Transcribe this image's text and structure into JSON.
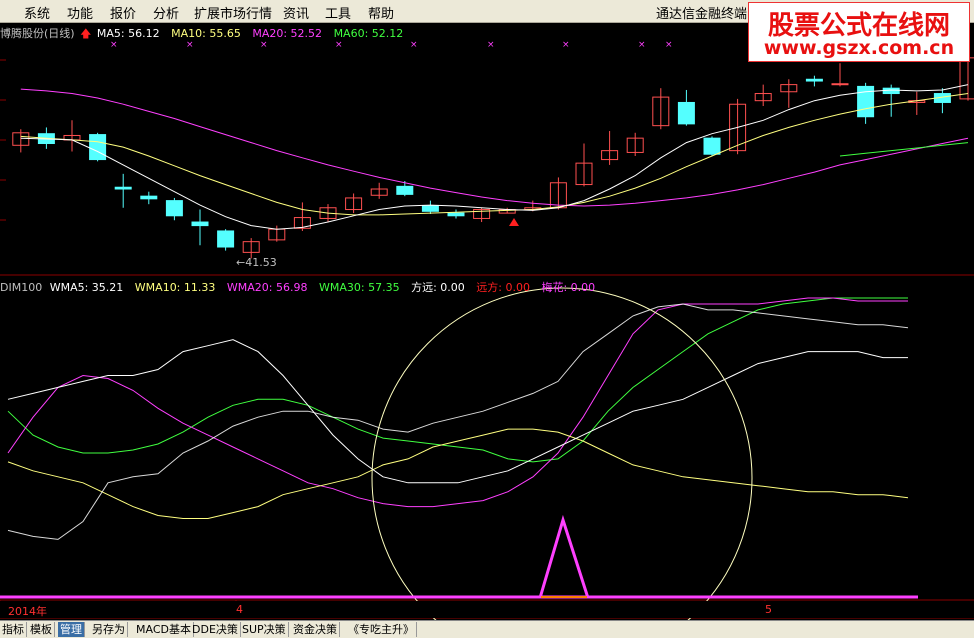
{
  "menu": {
    "items": [
      "系统",
      "功能",
      "报价",
      "分析",
      "扩展市场行情",
      "资讯",
      "工具",
      "帮助"
    ],
    "title": "通达信金融终端"
  },
  "watermark": {
    "line1": "股票公式在线网",
    "line2": "www.gszx.com.cn"
  },
  "main_panel": {
    "stock_name": "博腾股份(日线)",
    "ma5_label": "MA5: 56.12",
    "ma10_label": "MA10: 55.65",
    "ma20_label": "MA20: 52.52",
    "ma60_label": "MA60: 52.12",
    "low_label": "←41.53",
    "colors": {
      "ma5": "#ffffff",
      "ma10": "#ffff80",
      "ma20": "#ff40ff",
      "ma60": "#40ff40"
    }
  },
  "indicator_panel": {
    "name_label": "DIM100",
    "wma5_label": "WMA5: 35.21",
    "wma10_label": "WMA10: 11.33",
    "wma20_label": "WMA20: 56.98",
    "wma30_label": "WMA30: 57.35",
    "fangyuan_label": "方远: 0.00",
    "yuanfang_label": "远方: 0.00",
    "meihua_label": "梅花: 0.00"
  },
  "x_axis": {
    "year_label": "2014年",
    "month4": "4",
    "month5": "5"
  },
  "tabs": [
    "指标",
    "模板",
    "管理",
    "另存为",
    "MACD基本",
    "DDE决策",
    "SUP决策",
    "资金决策",
    "《专吃主升》"
  ],
  "active_tab": "管理",
  "chart_data": {
    "type": "candlestick",
    "candles": [
      {
        "o": 54.2,
        "c": 55.6,
        "h": 56.0,
        "l": 53.4
      },
      {
        "o": 55.5,
        "c": 54.4,
        "h": 56.2,
        "l": 53.8
      },
      {
        "o": 54.8,
        "c": 55.3,
        "h": 57.0,
        "l": 53.5
      },
      {
        "o": 55.4,
        "c": 52.6,
        "h": 55.6,
        "l": 52.4
      },
      {
        "o": 49.5,
        "c": 49.3,
        "h": 51.0,
        "l": 47.2
      },
      {
        "o": 48.5,
        "c": 48.2,
        "h": 49.0,
        "l": 47.6
      },
      {
        "o": 48.0,
        "c": 46.3,
        "h": 48.3,
        "l": 45.8
      },
      {
        "o": 45.6,
        "c": 45.2,
        "h": 47.0,
        "l": 43.0
      },
      {
        "o": 44.6,
        "c": 42.8,
        "h": 44.8,
        "l": 42.4
      },
      {
        "o": 42.2,
        "c": 43.4,
        "h": 43.8,
        "l": 41.53
      },
      {
        "o": 43.6,
        "c": 44.8,
        "h": 45.2,
        "l": 43.4
      },
      {
        "o": 44.9,
        "c": 46.1,
        "h": 47.8,
        "l": 44.6
      },
      {
        "o": 46.0,
        "c": 47.2,
        "h": 47.6,
        "l": 45.6
      },
      {
        "o": 47.0,
        "c": 48.3,
        "h": 48.8,
        "l": 46.6
      },
      {
        "o": 48.6,
        "c": 49.3,
        "h": 50.0,
        "l": 48.2
      },
      {
        "o": 49.6,
        "c": 48.7,
        "h": 50.2,
        "l": 48.5
      },
      {
        "o": 47.4,
        "c": 46.8,
        "h": 48.0,
        "l": 46.5
      },
      {
        "o": 46.6,
        "c": 46.3,
        "h": 47.0,
        "l": 46.0
      },
      {
        "o": 46.0,
        "c": 47.0,
        "h": 47.2,
        "l": 45.6
      },
      {
        "o": 46.6,
        "c": 47.0,
        "h": 47.2,
        "l": 46.6
      },
      {
        "o": 47.0,
        "c": 47.2,
        "h": 48.0,
        "l": 46.8
      },
      {
        "o": 47.2,
        "c": 50.0,
        "h": 50.6,
        "l": 47.0
      },
      {
        "o": 49.8,
        "c": 52.2,
        "h": 54.4,
        "l": 49.6
      },
      {
        "o": 52.6,
        "c": 53.6,
        "h": 55.8,
        "l": 52.0
      },
      {
        "o": 53.4,
        "c": 55.0,
        "h": 55.6,
        "l": 53.0
      },
      {
        "o": 56.4,
        "c": 59.6,
        "h": 60.6,
        "l": 56.0
      },
      {
        "o": 59.0,
        "c": 56.6,
        "h": 60.4,
        "l": 56.4
      },
      {
        "o": 55.0,
        "c": 53.2,
        "h": 55.2,
        "l": 53.0
      },
      {
        "o": 53.6,
        "c": 58.8,
        "h": 59.4,
        "l": 53.2
      },
      {
        "o": 59.2,
        "c": 60.0,
        "h": 61.0,
        "l": 58.6
      },
      {
        "o": 60.2,
        "c": 61.0,
        "h": 61.6,
        "l": 58.4
      },
      {
        "o": 61.6,
        "c": 61.4,
        "h": 62.0,
        "l": 60.8
      },
      {
        "o": 61.0,
        "c": 61.1,
        "h": 63.4,
        "l": 60.8
      },
      {
        "o": 60.8,
        "c": 57.4,
        "h": 61.2,
        "l": 56.6
      },
      {
        "o": 60.6,
        "c": 60.0,
        "h": 61.0,
        "l": 57.4
      },
      {
        "o": 59.0,
        "c": 59.2,
        "h": 60.2,
        "l": 57.6
      },
      {
        "o": 60.0,
        "c": 59.0,
        "h": 60.6,
        "l": 57.8
      },
      {
        "o": 59.4,
        "c": 64.0,
        "h": 65.0,
        "l": 59.2
      }
    ],
    "ma5": [
      55.0,
      54.9,
      54.8,
      53.5,
      52.0,
      50.5,
      49.0,
      47.5,
      46.2,
      45.2,
      44.8,
      45.0,
      45.6,
      46.3,
      47.0,
      47.4,
      47.5,
      47.4,
      47.2,
      47.0,
      46.9,
      47.2,
      48.0,
      49.3,
      50.8,
      52.8,
      54.5,
      55.5,
      56.2,
      57.0,
      58.2,
      59.2,
      59.8,
      60.2,
      60.4,
      60.3,
      60.4,
      61.0
    ],
    "ma10": [
      55.2,
      55.0,
      54.8,
      54.6,
      54.0,
      53.0,
      51.9,
      50.8,
      49.8,
      48.8,
      47.8,
      47.0,
      46.6,
      46.4,
      46.4,
      46.5,
      46.6,
      46.7,
      46.8,
      46.9,
      47.0,
      47.3,
      47.8,
      48.5,
      49.4,
      50.5,
      51.8,
      53.0,
      54.2,
      55.3,
      56.2,
      57.0,
      57.7,
      58.3,
      58.8,
      59.2,
      59.6,
      60.0
    ],
    "ma20": [
      60.5,
      60.3,
      60.0,
      59.5,
      58.8,
      58.0,
      57.2,
      56.3,
      55.4,
      54.5,
      53.6,
      52.8,
      52.0,
      51.3,
      50.6,
      50.0,
      49.4,
      48.9,
      48.4,
      48.0,
      47.7,
      47.5,
      47.4,
      47.5,
      47.7,
      48.0,
      48.3,
      48.7,
      49.2,
      49.8,
      50.5,
      51.2,
      52.0,
      52.6,
      53.2,
      53.8,
      54.4,
      55.0
    ],
    "ma60": [
      null,
      null,
      null,
      null,
      null,
      null,
      null,
      null,
      null,
      null,
      null,
      null,
      null,
      null,
      null,
      null,
      null,
      null,
      null,
      null,
      null,
      null,
      null,
      null,
      null,
      null,
      null,
      null,
      null,
      null,
      null,
      null,
      53.0,
      53.3,
      53.6,
      53.9,
      54.2,
      54.5
    ],
    "low_marker": 41.53,
    "indicator": {
      "wma5": [
        22,
        20,
        19,
        25,
        38,
        40,
        41,
        48,
        52,
        57,
        60,
        62,
        62,
        60,
        59,
        56,
        55,
        58,
        60,
        62,
        65,
        68,
        72,
        82,
        88,
        94,
        97,
        98,
        96,
        96,
        95,
        94,
        93,
        92,
        91,
        91,
        90
      ],
      "wma10": [
        45,
        42,
        40,
        38,
        34,
        30,
        27,
        26,
        26,
        28,
        30,
        34,
        36,
        38,
        40,
        44,
        46,
        50,
        52,
        54,
        56,
        56,
        55,
        52,
        48,
        44,
        42,
        40,
        39,
        38,
        37,
        36,
        35,
        35,
        34,
        34,
        33
      ],
      "wma20": [
        48,
        60,
        70,
        74,
        73,
        69,
        63,
        58,
        54,
        50,
        46,
        42,
        38,
        36,
        33,
        31,
        30,
        30,
        31,
        32,
        35,
        40,
        48,
        60,
        74,
        88,
        96,
        98,
        98,
        98,
        98,
        99,
        100,
        100,
        99,
        99,
        99
      ],
      "wma30": [
        62,
        54,
        50,
        48,
        48,
        49,
        51,
        55,
        60,
        64,
        66,
        66,
        64,
        60,
        56,
        53,
        52,
        51,
        50,
        49,
        46,
        45,
        46,
        52,
        62,
        70,
        76,
        82,
        88,
        92,
        96,
        98,
        99,
        100,
        100,
        100,
        100
      ],
      "dim100": [
        66,
        68,
        70,
        72,
        74,
        74,
        76,
        82,
        84,
        86,
        82,
        74,
        64,
        54,
        46,
        40,
        38,
        38,
        38,
        40,
        42,
        46,
        50,
        54,
        58,
        62,
        64,
        66,
        70,
        74,
        78,
        80,
        82,
        82,
        82,
        80,
        80
      ]
    }
  }
}
